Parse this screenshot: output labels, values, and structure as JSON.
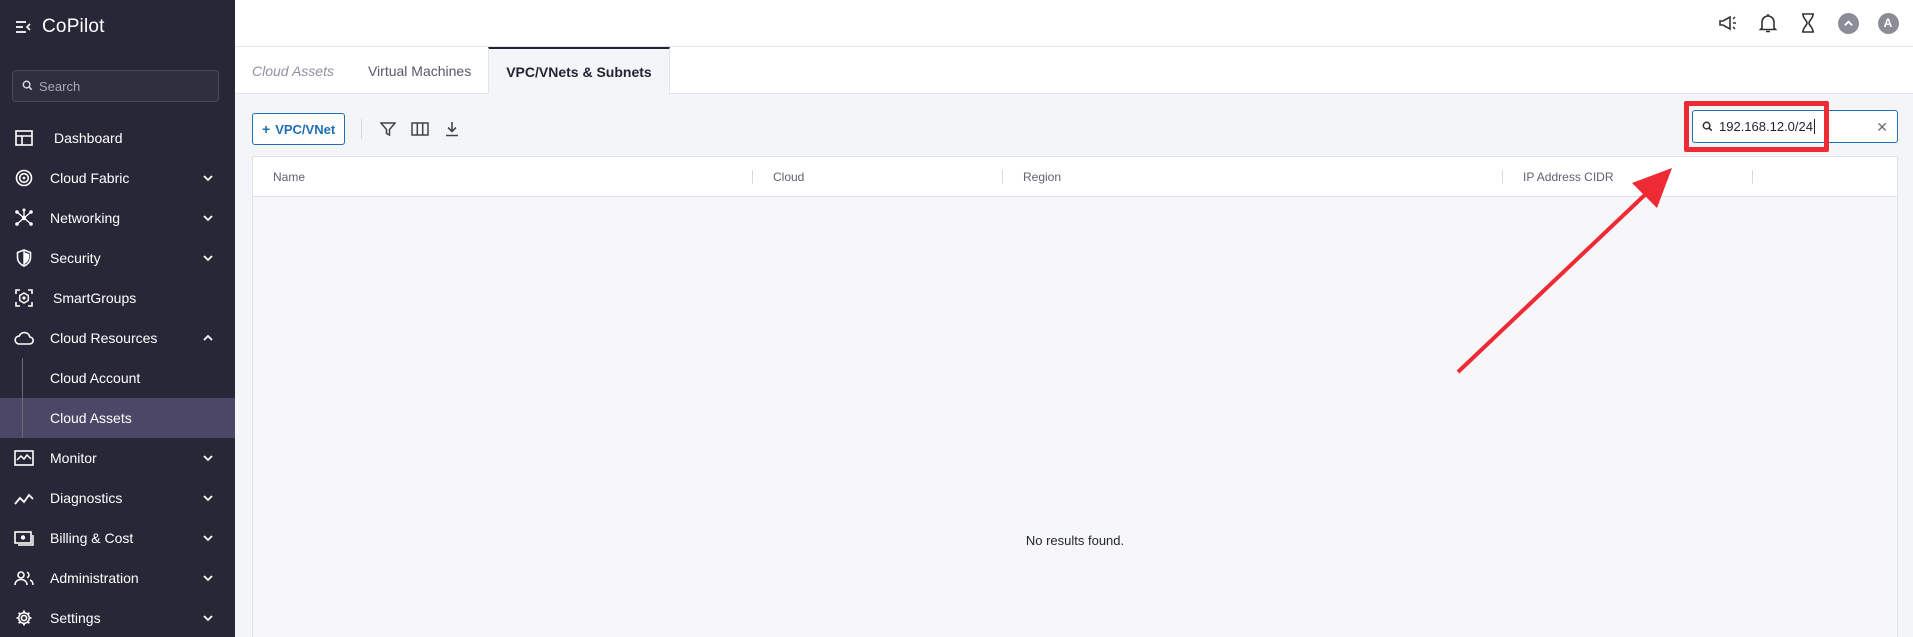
{
  "app": {
    "title": "CoPilot",
    "search_placeholder": "Search"
  },
  "sidebar": {
    "items": [
      {
        "label": "Dashboard",
        "icon": "dashboard-icon"
      },
      {
        "label": "Cloud Fabric",
        "icon": "cloud-fabric-icon",
        "expandable": true
      },
      {
        "label": "Networking",
        "icon": "networking-icon",
        "expandable": true
      },
      {
        "label": "Security",
        "icon": "shield-icon",
        "expandable": true
      },
      {
        "label": "SmartGroups",
        "icon": "smartgroups-icon"
      },
      {
        "label": "Cloud Resources",
        "icon": "cloud-icon",
        "expanded": true
      },
      {
        "label": "Cloud Account",
        "sub": true
      },
      {
        "label": "Cloud Assets",
        "sub": true,
        "active": true
      },
      {
        "label": "Monitor",
        "icon": "monitor-icon",
        "expandable": true
      },
      {
        "label": "Diagnostics",
        "icon": "diagnostics-icon",
        "expandable": true
      },
      {
        "label": "Billing & Cost",
        "icon": "billing-icon",
        "expandable": true
      },
      {
        "label": "Administration",
        "icon": "administration-icon",
        "expandable": true
      },
      {
        "label": "Settings",
        "icon": "gear-icon",
        "expandable": true
      }
    ]
  },
  "topbar": {
    "avatar_initial": "A"
  },
  "tabs": [
    {
      "label": "Cloud Assets"
    },
    {
      "label": "Virtual Machines"
    },
    {
      "label": "VPC/VNets & Subnets",
      "active": true
    }
  ],
  "toolbar": {
    "add_label": "VPC/VNet",
    "search_value": "192.168.12.0/24"
  },
  "table": {
    "columns": [
      "Name",
      "Cloud",
      "Region",
      "IP Address CIDR"
    ],
    "empty_message": "No results found."
  },
  "colors": {
    "sidebar_bg": "#282737",
    "active_item_bg": "#4c4766",
    "accent": "#1f6fb5",
    "annotation": "#ee2a35"
  }
}
